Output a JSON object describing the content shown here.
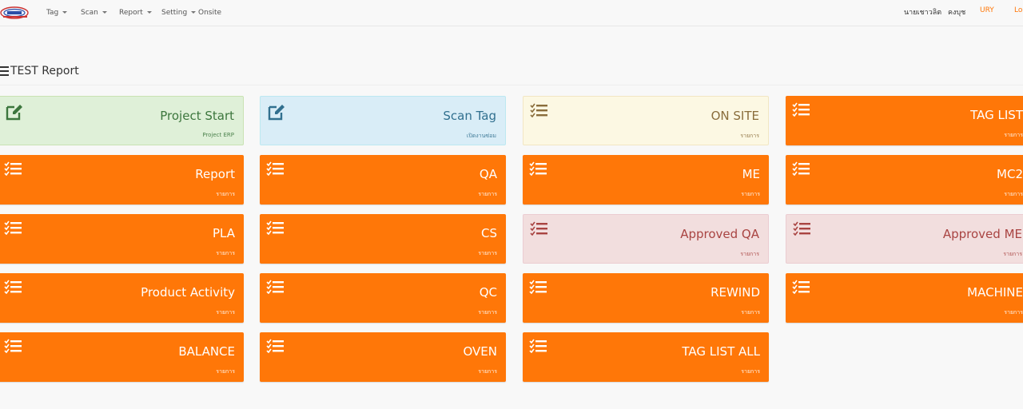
{
  "navbar": {
    "menu": [
      {
        "label": "Tag",
        "dropdown": true
      },
      {
        "label": "Scan",
        "dropdown": true
      },
      {
        "label": "Report",
        "dropdown": true
      },
      {
        "label": "Setting",
        "dropdown": true
      },
      {
        "label": "Onsite",
        "dropdown": false
      }
    ],
    "user_first": "นายเชาวลิต",
    "user_last": "คงบุช",
    "code": "URY",
    "logout": "Lo"
  },
  "page": {
    "title": "TEST Report"
  },
  "tiles": [
    {
      "title": "Project Start",
      "sub": "Project ERP",
      "style": "green",
      "icon": "edit-icon"
    },
    {
      "title": "Scan Tag",
      "sub": "เปิดงานซ่อม",
      "style": "blue",
      "icon": "edit-icon"
    },
    {
      "title": "ON SITE",
      "sub": "รายการ",
      "style": "yellow",
      "icon": "list-check-icon"
    },
    {
      "title": "TAG LIST",
      "sub": "รายการ",
      "style": "orange",
      "icon": "list-check-icon"
    },
    {
      "title": "Report",
      "sub": "รายการ",
      "style": "orange",
      "icon": "list-check-icon"
    },
    {
      "title": "QA",
      "sub": "รายการ",
      "style": "orange",
      "icon": "list-check-icon"
    },
    {
      "title": "ME",
      "sub": "รายการ",
      "style": "orange",
      "icon": "list-check-icon"
    },
    {
      "title": "MC2",
      "sub": "รายการ",
      "style": "orange",
      "icon": "list-check-icon"
    },
    {
      "title": "PLA",
      "sub": "รายการ",
      "style": "orange",
      "icon": "list-check-icon"
    },
    {
      "title": "CS",
      "sub": "รายการ",
      "style": "orange",
      "icon": "list-check-icon"
    },
    {
      "title": "Approved QA",
      "sub": "รายการ",
      "style": "red",
      "icon": "list-check-icon"
    },
    {
      "title": "Approved ME",
      "sub": "รายการ",
      "style": "red",
      "icon": "list-check-icon"
    },
    {
      "title": "Product Activity",
      "sub": "รายการ",
      "style": "orange",
      "icon": "list-check-icon"
    },
    {
      "title": "QC",
      "sub": "รายการ",
      "style": "orange",
      "icon": "list-check-icon"
    },
    {
      "title": "REWIND",
      "sub": "รายการ",
      "style": "orange",
      "icon": "list-check-icon"
    },
    {
      "title": "MACHINE",
      "sub": "รายการ",
      "style": "orange",
      "icon": "list-check-icon"
    },
    {
      "title": "BALANCE",
      "sub": "รายการ",
      "style": "orange",
      "icon": "list-check-icon"
    },
    {
      "title": "OVEN",
      "sub": "รายการ",
      "style": "orange",
      "icon": "list-check-icon"
    },
    {
      "title": "TAG LIST ALL",
      "sub": "รายการ",
      "style": "orange",
      "icon": "list-check-icon"
    }
  ],
  "colors": {
    "orange": "#ff7708",
    "green_text": "#3c763d",
    "blue_text": "#31708f",
    "yellow_text": "#8a6d3b",
    "red_text": "#a94442",
    "user_code": "#ff7708"
  }
}
